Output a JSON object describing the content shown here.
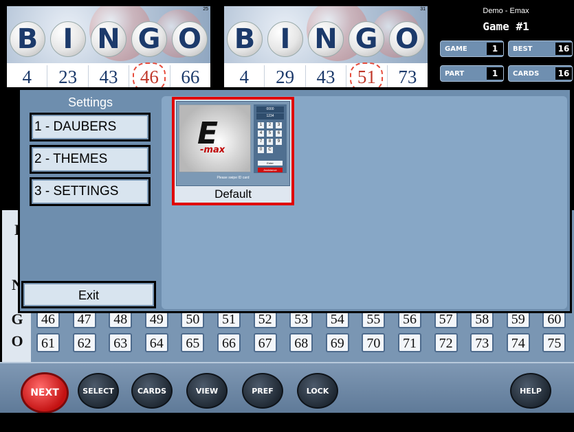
{
  "cards": [
    {
      "card_number": "25",
      "letters": [
        "B",
        "I",
        "N",
        "G",
        "O"
      ],
      "numbers": [
        "4",
        "23",
        "43",
        "46",
        "66"
      ],
      "starred_index": 3
    },
    {
      "card_number": "31",
      "letters": [
        "B",
        "I",
        "N",
        "G",
        "O"
      ],
      "numbers": [
        "4",
        "29",
        "43",
        "51",
        "73"
      ],
      "starred_index": 3
    }
  ],
  "game_panel": {
    "subtitle": "Demo - Emax",
    "title": "Game #1",
    "stats": [
      {
        "label": "GAME",
        "value": "1"
      },
      {
        "label": "BEST",
        "value": "16"
      },
      {
        "label": "PART",
        "value": "1"
      },
      {
        "label": "CARDS",
        "value": "16"
      }
    ]
  },
  "board": {
    "row_letters": [
      "I",
      "N",
      "G",
      "O"
    ],
    "row_g": [
      "46",
      "47",
      "48",
      "49",
      "50",
      "51",
      "52",
      "53",
      "54",
      "55",
      "56",
      "57",
      "58",
      "59",
      "60"
    ],
    "row_o": [
      "61",
      "62",
      "63",
      "64",
      "65",
      "66",
      "67",
      "68",
      "69",
      "70",
      "71",
      "72",
      "73",
      "74",
      "75"
    ]
  },
  "settings": {
    "title": "Settings",
    "menu": [
      {
        "label": "1 - DAUBERS"
      },
      {
        "label": "2 - THEMES"
      },
      {
        "label": "3 - SETTINGS"
      }
    ],
    "exit_label": "Exit",
    "themes": [
      {
        "name": "Default",
        "preview": {
          "logo_text": "E",
          "logo_subtext": "-max",
          "readout": [
            "0000",
            "1234"
          ],
          "keys": [
            "1",
            "2",
            "3",
            "4",
            "5",
            "6",
            "7",
            "8",
            "9",
            "0",
            "C"
          ],
          "enter_label": "Enter",
          "assist_label": "Assistance",
          "swipe_text": "Please swipe ID card"
        }
      }
    ]
  },
  "toolbar": {
    "buttons": [
      "NEXT",
      "SELECT",
      "CARDS",
      "VIEW",
      "PREF",
      "LOCK",
      "HELP"
    ]
  },
  "colors": {
    "accent_red": "#e00000",
    "panel_blue": "#6e8eae",
    "light_blue": "#87a7c6"
  }
}
